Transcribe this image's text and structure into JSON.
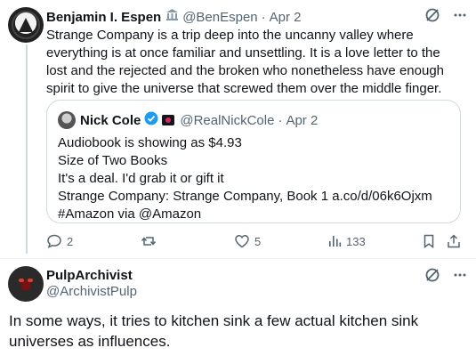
{
  "tweet1": {
    "name": "Benjamin I. Espen",
    "handle": "@BenEspen",
    "date": "Apr 2",
    "text": "Strange Company is a trip deep into the uncanny valley where everything is at once familiar and unsettling. It is a love letter to the lost and the rejected and the broken who nonetheless have enough spirit to give the universe that screwed them over the middle finger.",
    "quote": {
      "name": "Nick Cole",
      "handle": "@RealNickCole",
      "date": "Apr 2",
      "lines": [
        "Audiobook is showing as $4.93",
        "Size of Two Books",
        "It's a deal. I'd grab it or gift it",
        "Strange Company: Strange Company, Book 1 a.co/d/06k6Ojxm",
        "#Amazon via @Amazon"
      ]
    },
    "actions": {
      "replies": "2",
      "reposts": "",
      "likes": "5",
      "views": "133"
    }
  },
  "tweet2": {
    "name": "PulpArchivist",
    "handle": "@ArchivistPulp",
    "text": "In some ways, it tries to kitchen sink a few actual kitchen sink universes as influences."
  },
  "icons": {
    "government": "government-badge-icon",
    "verified": "verified-badge-icon",
    "grok": "grok-icon",
    "more": "more-icon",
    "reply": "reply-icon",
    "repost": "repost-icon",
    "like": "like-icon",
    "views": "views-icon",
    "bookmark": "bookmark-icon",
    "share": "share-icon"
  },
  "colors": {
    "text": "#0f1419",
    "secondary": "#536471",
    "border": "#cfd9de",
    "verified": "#1d9bf0"
  }
}
